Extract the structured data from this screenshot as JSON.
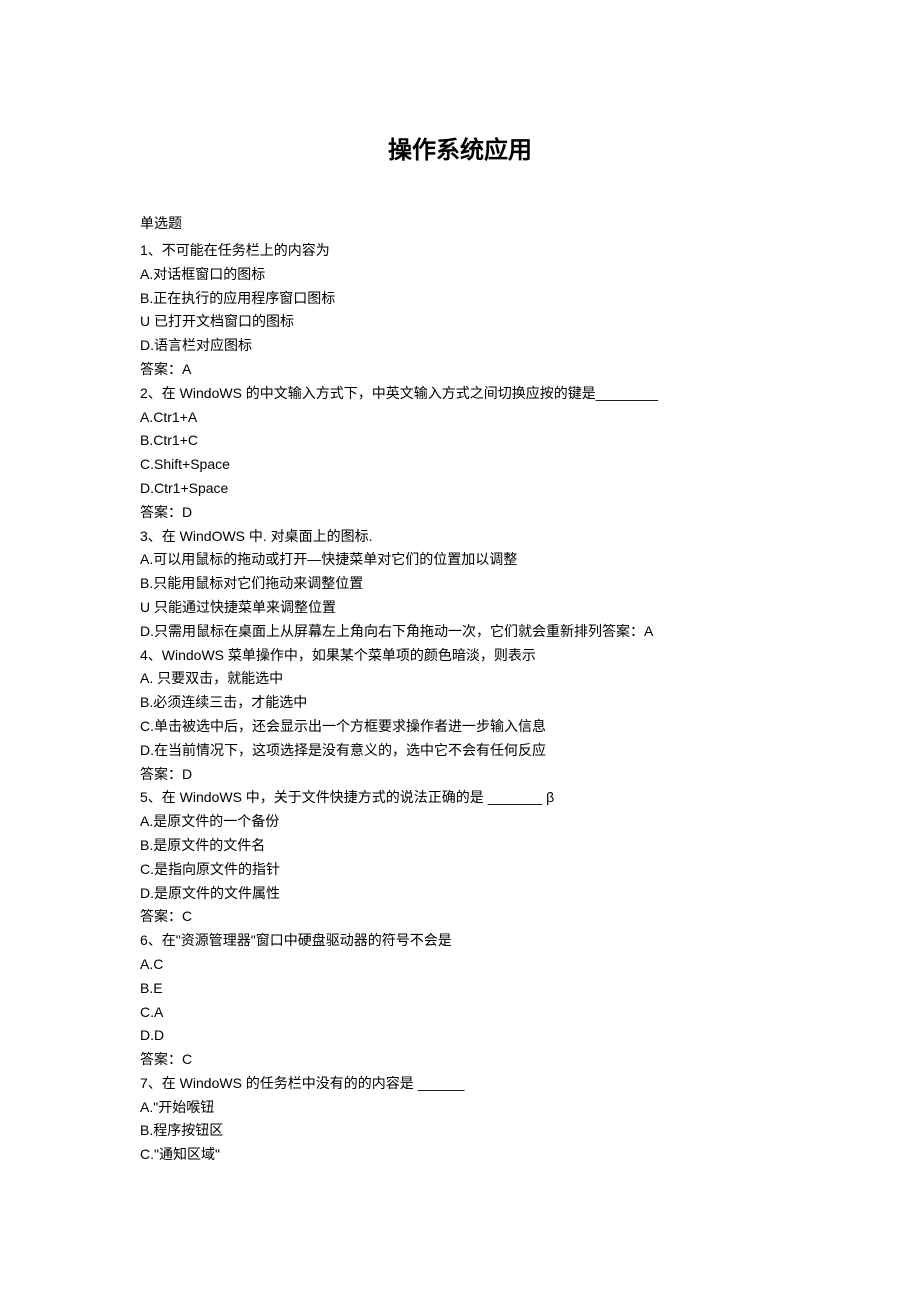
{
  "title": "操作系统应用",
  "section_label": "单选题",
  "lines": [
    "1、不可能在任务栏上的内容为",
    "A.对话框窗口的图标",
    "B.正在执行的应用程序窗口图标",
    "U 已打开文档窗口的图标",
    "D.语言栏对应图标",
    "答案：A",
    "2、在 WindoWS 的中文输入方式下，中英文输入方式之间切换应按的键是________",
    "A.Ctr1+A",
    "B.Ctr1+C",
    "C.Shift+Space",
    "D.Ctr1+Space",
    "答案：D",
    "3、在 WindOWS 中. 对桌面上的图标.",
    "A.可以用鼠标的拖动或打开—快捷菜单对它们的位置加以调整",
    "B.只能用鼠标对它们拖动来调整位置",
    "U 只能通过快捷菜单来调整位置",
    "D.只需用鼠标在桌面上从屏幕左上角向右下角拖动一次，它们就会重新排列答案：A",
    "4、WindoWS 菜单操作中，如果某个菜单项的颜色暗淡，则表示",
    "A. 只要双击，就能选中",
    "B.必须连续三击，才能选中",
    "C.单击被选中后，还会显示出一个方框要求操作者进一步输入信息",
    "D.在当前情况下，这项选择是没有意义的，选中它不会有任何反应",
    "答案：D",
    "5、在 WindoWS 中，关于文件快捷方式的说法正确的是 _______ β",
    "A.是原文件的一个备份",
    "B.是原文件的文件名",
    "C.是指向原文件的指针",
    "D.是原文件的文件属性",
    "答案：C",
    "6、在\"资源管理器\"窗口中硬盘驱动器的符号不会是",
    "A.C",
    "B.E",
    "C.A",
    "D.D",
    "答案：C",
    "7、在 WindoWS 的任务栏中没有的的内容是 ______",
    "A.\"开始喉钮",
    "B.程序按钮区",
    "C.\"通知区域\""
  ]
}
